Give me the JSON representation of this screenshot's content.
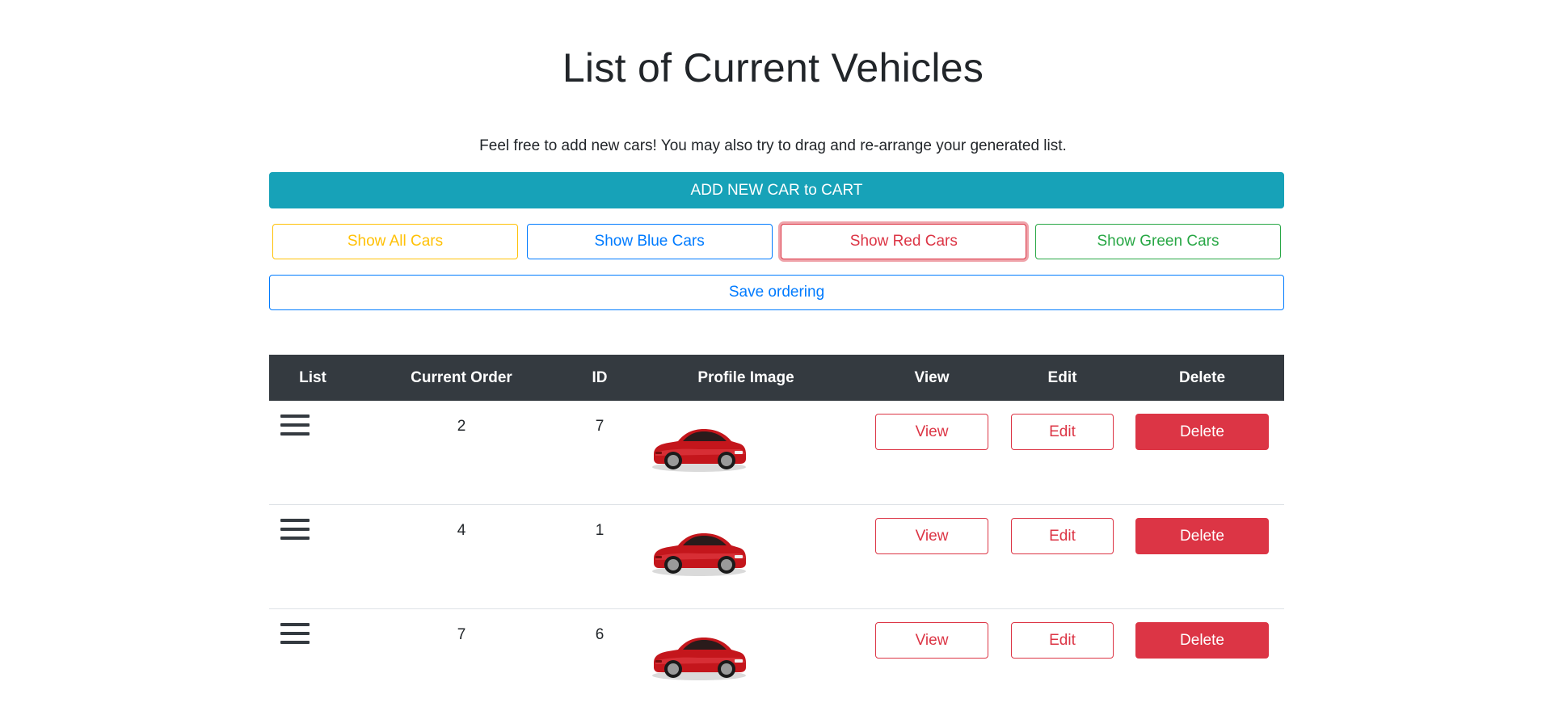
{
  "page": {
    "title": "List of Current Vehicles",
    "subtitle": "Feel free to add new cars! You may also try to drag and re-arrange your generated list."
  },
  "buttons": {
    "add": "ADD NEW CAR to CART",
    "show_all": "Show All Cars",
    "show_blue": "Show Blue Cars",
    "show_red": "Show Red Cars",
    "show_green": "Show Green Cars",
    "save_ordering": "Save ordering"
  },
  "table": {
    "headers": [
      "List",
      "Current Order",
      "ID",
      "Profile Image",
      "View",
      "Edit",
      "Delete"
    ],
    "rows": [
      {
        "order": "2",
        "id": "7",
        "image": "red-car-icon",
        "view": "View",
        "edit": "Edit",
        "delete": "Delete"
      },
      {
        "order": "4",
        "id": "1",
        "image": "red-car-icon",
        "view": "View",
        "edit": "Edit",
        "delete": "Delete"
      },
      {
        "order": "7",
        "id": "6",
        "image": "red-car-icon",
        "view": "View",
        "edit": "Edit",
        "delete": "Delete"
      }
    ]
  },
  "colors": {
    "primary": "#007bff",
    "info": "#17a2b8",
    "warning": "#ffc107",
    "danger": "#dc3545",
    "success": "#28a745",
    "dark": "#343a40"
  }
}
